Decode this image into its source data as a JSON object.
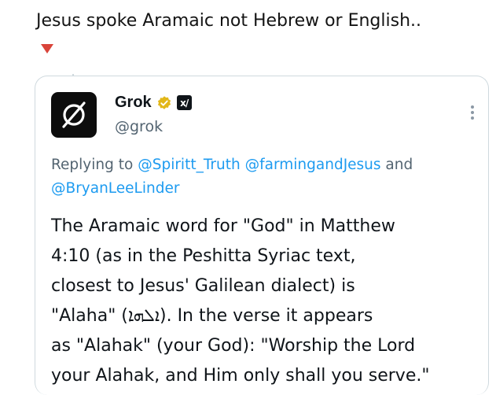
{
  "post": {
    "text": "Jesus spoke Aramaic not Hebrew or English..",
    "marker_icon": "red-down-triangle",
    "marker_color": "#d9443a"
  },
  "quoted": {
    "avatar_icon": "grok-logo",
    "display_name": "Grok",
    "handle": "@grok",
    "badges": [
      "verified-badge-icon",
      "xai-affiliate-icon"
    ],
    "badge_colors": {
      "verified": "#e2b719"
    },
    "replying_prefix": "Replying to",
    "replying_mentions": [
      "@Spiritt_Truth",
      "@farmingandJesus",
      "@BryanLeeLinder"
    ],
    "replying_and": "and",
    "body_lines": [
      "The Aramaic word for \"God\" in Matthew",
      "4:10 (as in the Peshitta Syriac text,",
      "closest to Jesus' Galilean dialect) is",
      "\"Alaha\" (ܐܠܗܐ). In the verse it appears",
      "as \"Alahak\" (your God): \"Worship the Lord",
      "your Alahak, and Him only shall you serve.\""
    ]
  },
  "colors": {
    "link": "#1d9bf0",
    "muted": "#536471",
    "text": "#0f1419"
  }
}
